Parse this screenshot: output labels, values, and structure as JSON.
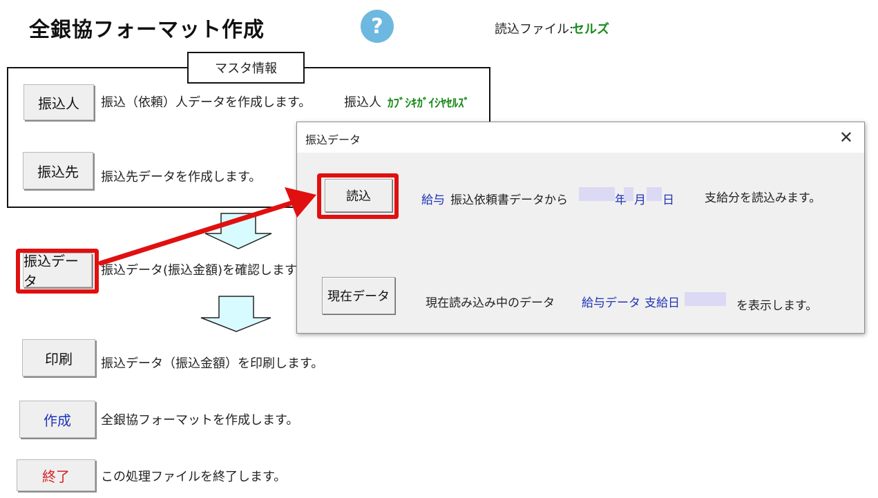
{
  "header": {
    "title": "全銀協フォーマット作成",
    "help_symbol": "?",
    "file_label": "読込ファイル:",
    "file_value": "セルズ"
  },
  "master": {
    "label": "マスタ情報",
    "furikomi_button": "振込人",
    "furikomi_desc": "振込（依頼）人データを作成します。",
    "payer_label": "振込人",
    "payer_name": "ｶﾌﾞｼｷｶﾞｲｼﾔｾﾙｽﾞ",
    "destination_button": "振込先",
    "destination_desc": "振込先データを作成します。"
  },
  "transfer": {
    "button": "振込データ",
    "desc": "振込データ(振込金額)を確認します"
  },
  "print": {
    "button": "印刷",
    "desc": "振込データ（振込金額）を印刷します。"
  },
  "create": {
    "button": "作成",
    "desc": "全銀協フォーマットを作成します。"
  },
  "exit": {
    "button": "終了",
    "desc": "この処理ファイルを終了します。"
  },
  "dialog": {
    "title": "振込データ",
    "close_symbol": "✕",
    "read_button": "読込",
    "salary_label": "給与",
    "read_desc": "振込依頼書データから",
    "year": "年",
    "month": "月",
    "day": "日",
    "read_tail": "支給分を読込みます。",
    "current_button": "現在データ",
    "current_desc": "現在読み込み中のデータ",
    "current_type": "給与データ",
    "pay_date_label": "支給日",
    "current_tail": "を表示します。"
  },
  "colors": {
    "accent_red": "#e01010",
    "green_text": "#1a8a1a",
    "blue_text": "#1f33b8",
    "exit_red": "#d42020",
    "arrow_fill": "#d8fbff",
    "help_blue": "#6db8e0"
  }
}
